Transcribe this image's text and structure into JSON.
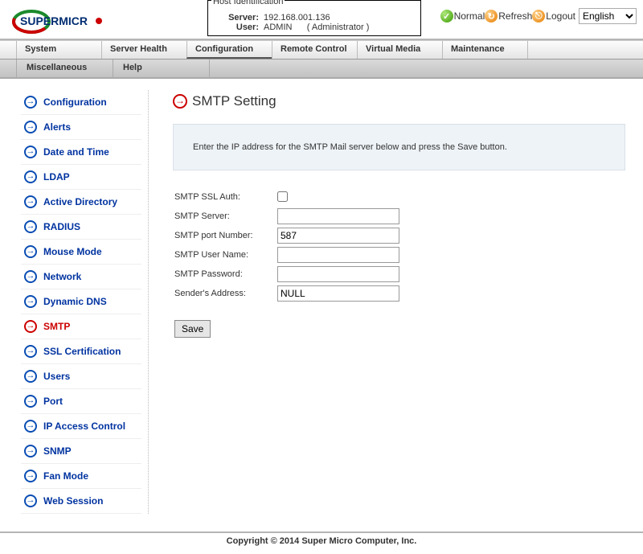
{
  "header": {
    "host_id_legend": "Host Identification",
    "server_label": "Server:",
    "server_value": "192.168.001.136",
    "user_label": "User:",
    "user_value": "ADMIN",
    "user_role": "( Administrator )",
    "normal_label": "Normal",
    "refresh_label": "Refresh",
    "logout_label": "Logout",
    "language": "English"
  },
  "menu": {
    "items": [
      "System",
      "Server Health",
      "Configuration",
      "Remote Control",
      "Virtual Media",
      "Maintenance"
    ],
    "active_index": 2,
    "sub_items": [
      "Miscellaneous",
      "Help"
    ]
  },
  "sidebar": {
    "items": [
      "Configuration",
      "Alerts",
      "Date and Time",
      "LDAP",
      "Active Directory",
      "RADIUS",
      "Mouse Mode",
      "Network",
      "Dynamic DNS",
      "SMTP",
      "SSL Certification",
      "Users",
      "Port",
      "IP Access Control",
      "SNMP",
      "Fan Mode",
      "Web Session"
    ],
    "active_index": 9
  },
  "page": {
    "title": "SMTP Setting",
    "infobox": "Enter the IP address for the SMTP Mail server below and press the Save button.",
    "form": {
      "ssl_auth_label": "SMTP SSL Auth:",
      "ssl_auth_checked": false,
      "server_label": "SMTP Server:",
      "server_value": "",
      "port_label": "SMTP port Number:",
      "port_value": "587",
      "user_label": "SMTP User Name:",
      "user_value": "",
      "pass_label": "SMTP Password:",
      "pass_value": "",
      "sender_label": "Sender's Address:",
      "sender_value": "NULL",
      "save_label": "Save"
    }
  },
  "footer": "Copyright © 2014 Super Micro Computer, Inc."
}
